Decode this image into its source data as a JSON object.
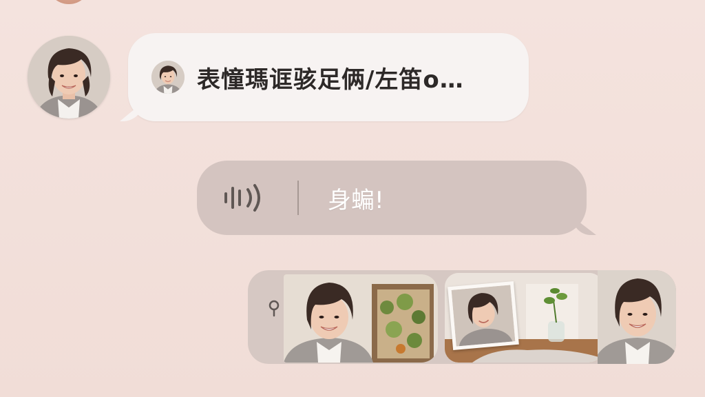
{
  "conversation": {
    "incoming_message": {
      "text": "表憧瑪诓骇足俩/左笛o…",
      "sender_avatar": "user-avatar-woman"
    },
    "voice_message": {
      "icon": "sound-wave-icon",
      "transcript": "身蝙!"
    },
    "media_attachment": {
      "icon": "location-pin-icon",
      "photos": [
        {
          "subject": "woman-selfie-with-plant-art"
        },
        {
          "subject": "polaroid-in-room-with-vase"
        },
        {
          "subject": "woman-smiling-portrait"
        }
      ]
    }
  },
  "colors": {
    "background": "#f3e1dc",
    "incoming_bubble": "#f7f3f2",
    "voice_bubble": "#d4c4c0",
    "media_strip": "#d6c8c3"
  }
}
